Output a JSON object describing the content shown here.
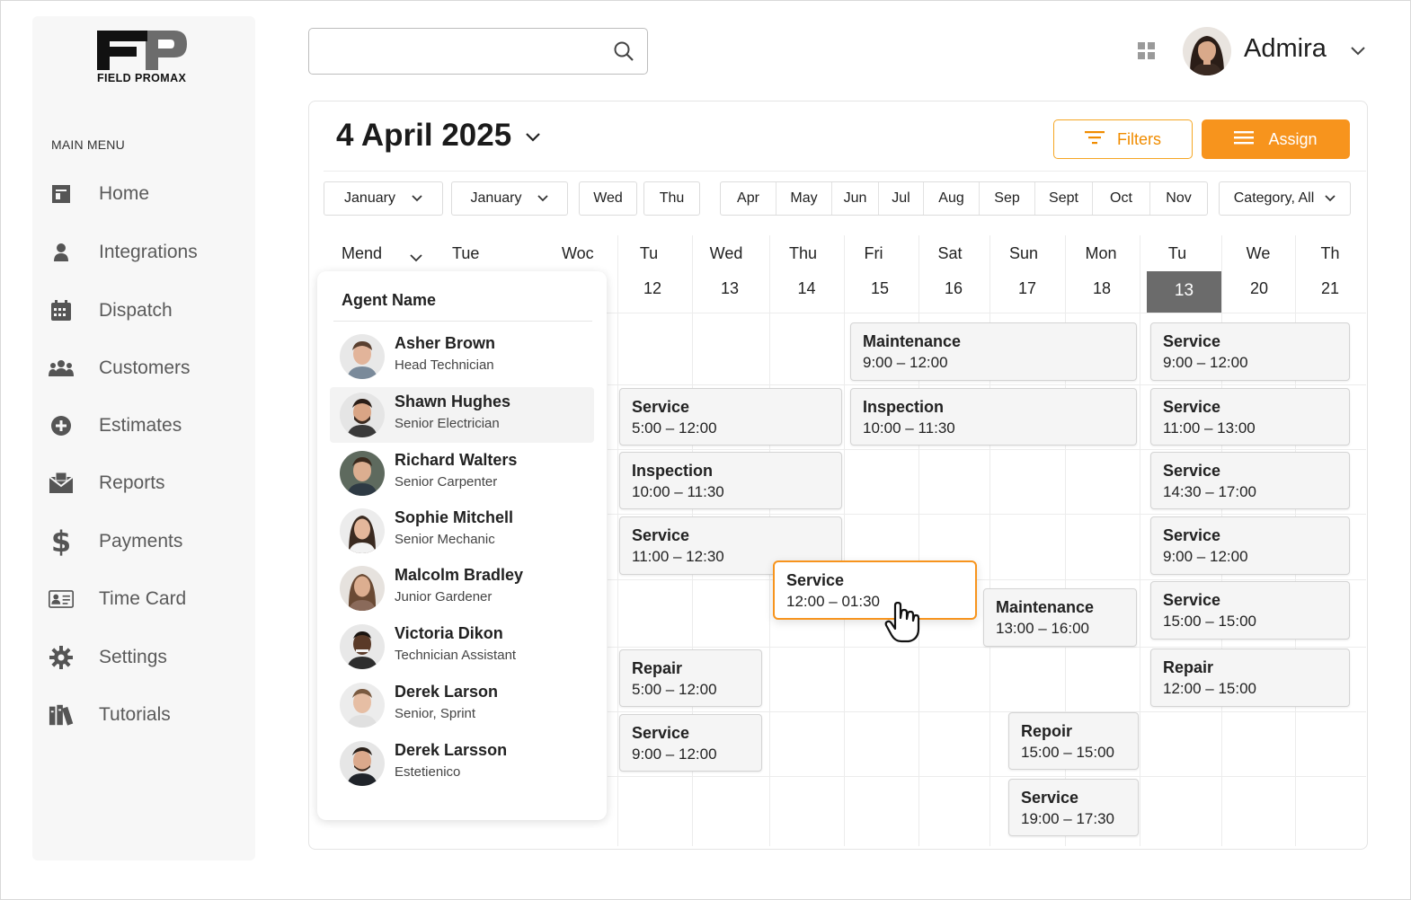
{
  "app": {
    "logo_text": "FIELD PROMAX",
    "logo_mark": "FP"
  },
  "sidebar": {
    "menu_title": "MAIN MENU",
    "items": [
      {
        "label": "Home",
        "icon": "home-icon"
      },
      {
        "label": "Integrations",
        "icon": "person-icon"
      },
      {
        "label": "Dispatch",
        "icon": "calendar-icon"
      },
      {
        "label": "Customers",
        "icon": "group-icon"
      },
      {
        "label": "Estimates",
        "icon": "plus-circle-icon"
      },
      {
        "label": "Reports",
        "icon": "envelope-icon"
      },
      {
        "label": "Payments",
        "icon": "dollar-icon"
      },
      {
        "label": "Time Card",
        "icon": "id-card-icon"
      },
      {
        "label": "Settings",
        "icon": "gear-icon"
      },
      {
        "label": "Tutorials",
        "icon": "books-icon"
      }
    ]
  },
  "header": {
    "search_placeholder": "",
    "user_name": "Admira"
  },
  "toolbar": {
    "date": "4 April 2025",
    "filters_label": "Filters",
    "assign_label": "Assign"
  },
  "filters": {
    "month_a": "January",
    "month_b": "January",
    "day_a": "Wed",
    "day_b": "Thu",
    "months": [
      "Apr",
      "May",
      "Jun",
      "Jul",
      "Aug",
      "Sep",
      "Sept",
      "Oct",
      "Nov"
    ],
    "category": "Category, All"
  },
  "calendar": {
    "left_heads": [
      "Mend",
      "Tue",
      "Woc"
    ],
    "columns": [
      {
        "day": "Tu",
        "num": "12"
      },
      {
        "day": "Wed",
        "num": "13"
      },
      {
        "day": "Thu",
        "num": "14"
      },
      {
        "day": "Fri",
        "num": "15"
      },
      {
        "day": "Sat",
        "num": "16"
      },
      {
        "day": "Sun",
        "num": "17"
      },
      {
        "day": "Mon",
        "num": "18"
      },
      {
        "day": "Tu",
        "num": "13"
      },
      {
        "day": "We",
        "num": "20"
      },
      {
        "day": "Th",
        "num": "21"
      }
    ],
    "today_index": 7
  },
  "agents": {
    "title": "Agent Name",
    "list": [
      {
        "name": "Asher Brown",
        "role": "Head Technician"
      },
      {
        "name": "Shawn Hughes",
        "role": "Senior Electrician"
      },
      {
        "name": "Richard Walters",
        "role": "Senior Carpenter"
      },
      {
        "name": "Sophie Mitchell",
        "role": "Senior Mechanic"
      },
      {
        "name": "Malcolm Bradley",
        "role": "Junior Gardener"
      },
      {
        "name": "Victoria Dikon",
        "role": "Technician Assistant"
      },
      {
        "name": "Derek Larson",
        "role": "Senior, Sprint"
      },
      {
        "name": "Derek Larsson",
        "role": "Estetienico"
      }
    ],
    "active_index": 1
  },
  "events": [
    {
      "title": "Maintenance",
      "time": "9:00 – 12:00"
    },
    {
      "title": "Service",
      "time": "9:00 – 12:00"
    },
    {
      "title": "Service",
      "time": "5:00 – 12:00"
    },
    {
      "title": "Inspection",
      "time": "10:00 – 11:30"
    },
    {
      "title": "Service",
      "time": "11:00 – 13:00"
    },
    {
      "title": "Inspection",
      "time": "10:00 – 11:30"
    },
    {
      "title": "Service",
      "time": "14:30 – 17:00"
    },
    {
      "title": "Service",
      "time": "11:00 – 12:30"
    },
    {
      "title": "Service",
      "time": "9:00 – 12:00"
    },
    {
      "title": "Service",
      "time": "12:00 – 01:30"
    },
    {
      "title": "Maintenance",
      "time": "13:00 – 16:00"
    },
    {
      "title": "Service",
      "time": "15:00 – 15:00"
    },
    {
      "title": "Repair",
      "time": "5:00 – 12:00"
    },
    {
      "title": "Repair",
      "time": "12:00 – 15:00"
    },
    {
      "title": "Service",
      "time": "9:00 – 12:00"
    },
    {
      "title": "Repoir",
      "time": "15:00 – 15:00"
    },
    {
      "title": "Service",
      "time": "19:00 – 17:30"
    }
  ],
  "colors": {
    "accent": "#f7941d",
    "today": "#6b6b6b",
    "event_bg": "#f5f5f5"
  }
}
